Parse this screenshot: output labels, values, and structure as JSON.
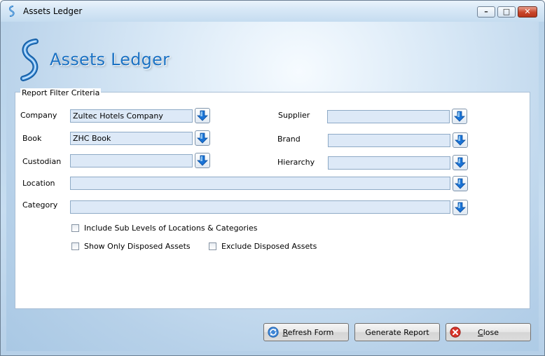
{
  "window": {
    "title": "Assets Ledger",
    "minimize_label": "–",
    "maximize_label": "□",
    "close_label": "✕"
  },
  "header": {
    "title": "Assets Ledger"
  },
  "filter": {
    "group_title": "Report Filter Criteria",
    "company_label": "Company",
    "company_value": "Zultec Hotels Company",
    "book_label": "Book",
    "book_value": "ZHC Book",
    "custodian_label": "Custodian",
    "custodian_value": "",
    "location_label": "Location",
    "location_value": "",
    "category_label": "Category",
    "category_value": "",
    "supplier_label": "Supplier",
    "supplier_value": "",
    "brand_label": "Brand",
    "brand_value": "",
    "hierarchy_label": "Hierarchy",
    "hierarchy_value": "",
    "include_sub_levels_label": "Include Sub  Levels of Locations & Categories",
    "include_sub_levels_checked": false,
    "show_only_disposed_label": "Show Only Disposed Assets",
    "show_only_disposed_checked": false,
    "exclude_disposed_label": "Exclude Disposed Assets",
    "exclude_disposed_checked": false
  },
  "buttons": {
    "refresh_first": "R",
    "refresh_rest": "efresh Form",
    "generate_label": "Generate Report",
    "close_first": "C",
    "close_rest": "lose"
  },
  "colors": {
    "accent": "#1b72c4",
    "field_bg": "#dde9f7",
    "pick_arrow": "#1a73d6"
  },
  "icons": {
    "app": "ledger-logo-icon",
    "pick": "down-arrow-icon",
    "refresh": "refresh-icon",
    "close": "close-circle-icon"
  }
}
